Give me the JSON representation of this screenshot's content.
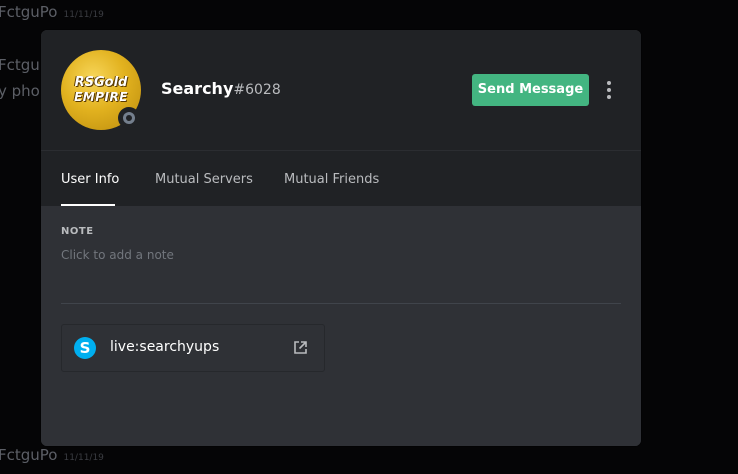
{
  "background": {
    "line1": "FctguPo",
    "line2": "FctguPo",
    "line3": "y phon",
    "line4": "FctguPo"
  },
  "profile": {
    "avatar_line1": "RSGold",
    "avatar_line2": "EMPIRE",
    "username": "Searchy",
    "discriminator": "#6028",
    "status_color": "#747f8d",
    "send_message_label": "Send Message",
    "accent_color": "#43b581"
  },
  "tabs": [
    {
      "label": "User Info",
      "active": true
    },
    {
      "label": "Mutual Servers",
      "active": false
    },
    {
      "label": "Mutual Friends",
      "active": false
    }
  ],
  "user_info": {
    "note_title": "NOTE",
    "note_placeholder": "Click to add a note",
    "connected_accounts": [
      {
        "service_icon": "skype-icon",
        "service_icon_glyph": "S",
        "name": "live:searchyups",
        "action_icon": "external-link-icon"
      }
    ]
  }
}
